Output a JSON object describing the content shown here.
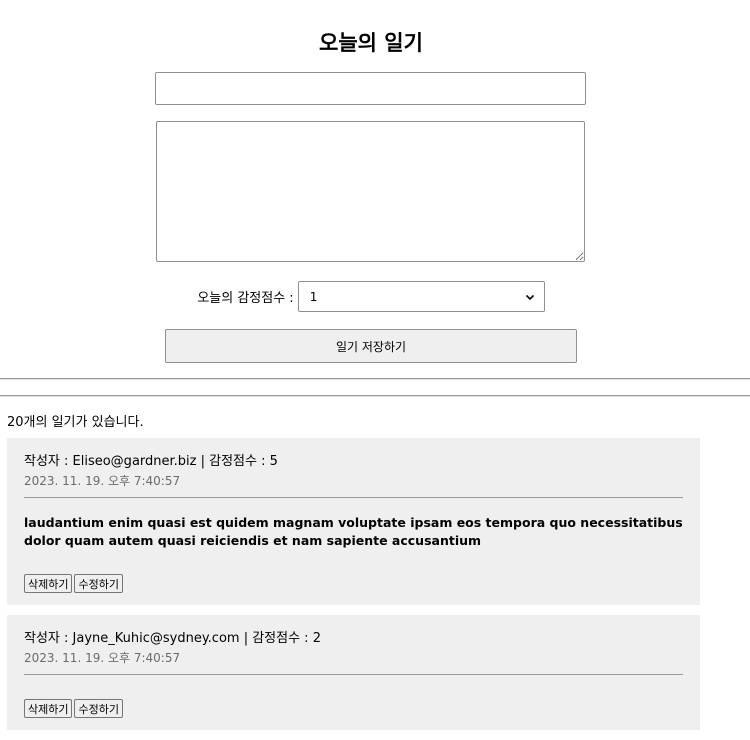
{
  "editor": {
    "title": "오늘의 일기",
    "author_value": "",
    "content_value": "",
    "emotion_label": "오늘의 감정점수 :",
    "emotion_selected": "1",
    "save_label": "일기 저장하기"
  },
  "list": {
    "count_text": "20개의 일기가 있습니다.",
    "items": [
      {
        "info": "작성자 : Eliseo@gardner.biz | 감정점수 : 5",
        "date": "2023. 11. 19. 오후 7:40:57",
        "content": "laudantium enim quasi est quidem magnam voluptate ipsam eos tempora quo necessitatibus dolor quam autem quasi reiciendis et nam sapiente accusantium",
        "delete_label": "삭제하기",
        "edit_label": "수정하기"
      },
      {
        "info": "작성자 : Jayne_Kuhic@sydney.com | 감정점수 : 2",
        "date": "2023. 11. 19. 오후 7:40:57",
        "content": "",
        "delete_label": "삭제하기",
        "edit_label": "수정하기"
      }
    ]
  },
  "icons": {
    "select_arrow": "chevron-down-icon"
  }
}
